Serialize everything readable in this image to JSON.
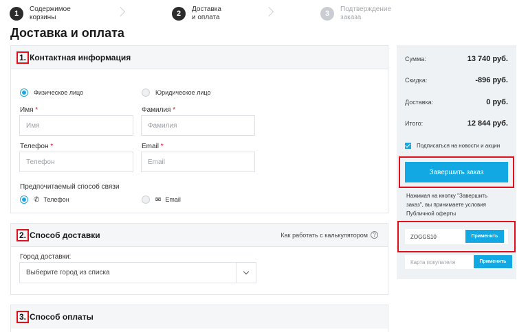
{
  "steps": [
    {
      "num": "1",
      "line1": "Содержимое",
      "line2": "корзины"
    },
    {
      "num": "2",
      "line1": "Доставка",
      "line2": "и оплата"
    },
    {
      "num": "3",
      "line1": "Подтверждение",
      "line2": "заказа"
    }
  ],
  "page_title": "Доставка и оплата",
  "contact": {
    "num": "1.",
    "title": "Контактная информация",
    "person_types": [
      "Физическое лицо",
      "Юридическое лицо"
    ],
    "first_name": {
      "label": "Имя",
      "placeholder": "Имя"
    },
    "last_name": {
      "label": "Фамилия",
      "placeholder": "Фамилия"
    },
    "phone": {
      "label": "Телефон",
      "placeholder": "Телефон"
    },
    "email": {
      "label": "Email",
      "placeholder": "Email"
    },
    "req_mark": "*",
    "contact_method_label": "Предпочитаемый способ связи",
    "contact_methods": [
      "Телефон",
      "Email"
    ]
  },
  "delivery": {
    "num": "2.",
    "title": "Способ доставки",
    "calc_link": "Как работать с калькулятором",
    "calc_help": "?",
    "city_label": "Город доставки:",
    "city_placeholder": "Выберите город из списка"
  },
  "payment": {
    "num": "3.",
    "title": "Способ оплаты"
  },
  "summary": {
    "rows": [
      {
        "label": "Сумма:",
        "value": "13 740 руб."
      },
      {
        "label": "Скидка:",
        "value": "-896 руб."
      },
      {
        "label": "Доставка:",
        "value": "0 руб."
      },
      {
        "label": "Итого:",
        "value": "12 844 руб."
      }
    ],
    "subscribe": "Подписаться на новости и акции",
    "submit": "Завершить заказ",
    "note": "Нажимая на кнопку \"Завершить заказ\", вы принимаете условия Публичной оферты",
    "promo_code": "ZOGGS10",
    "apply": "Применить",
    "card_placeholder": "Карта покупателя",
    "apply2": "Применить"
  },
  "colors": {
    "accent": "#12a8e4",
    "highlight": "#e0101a"
  }
}
